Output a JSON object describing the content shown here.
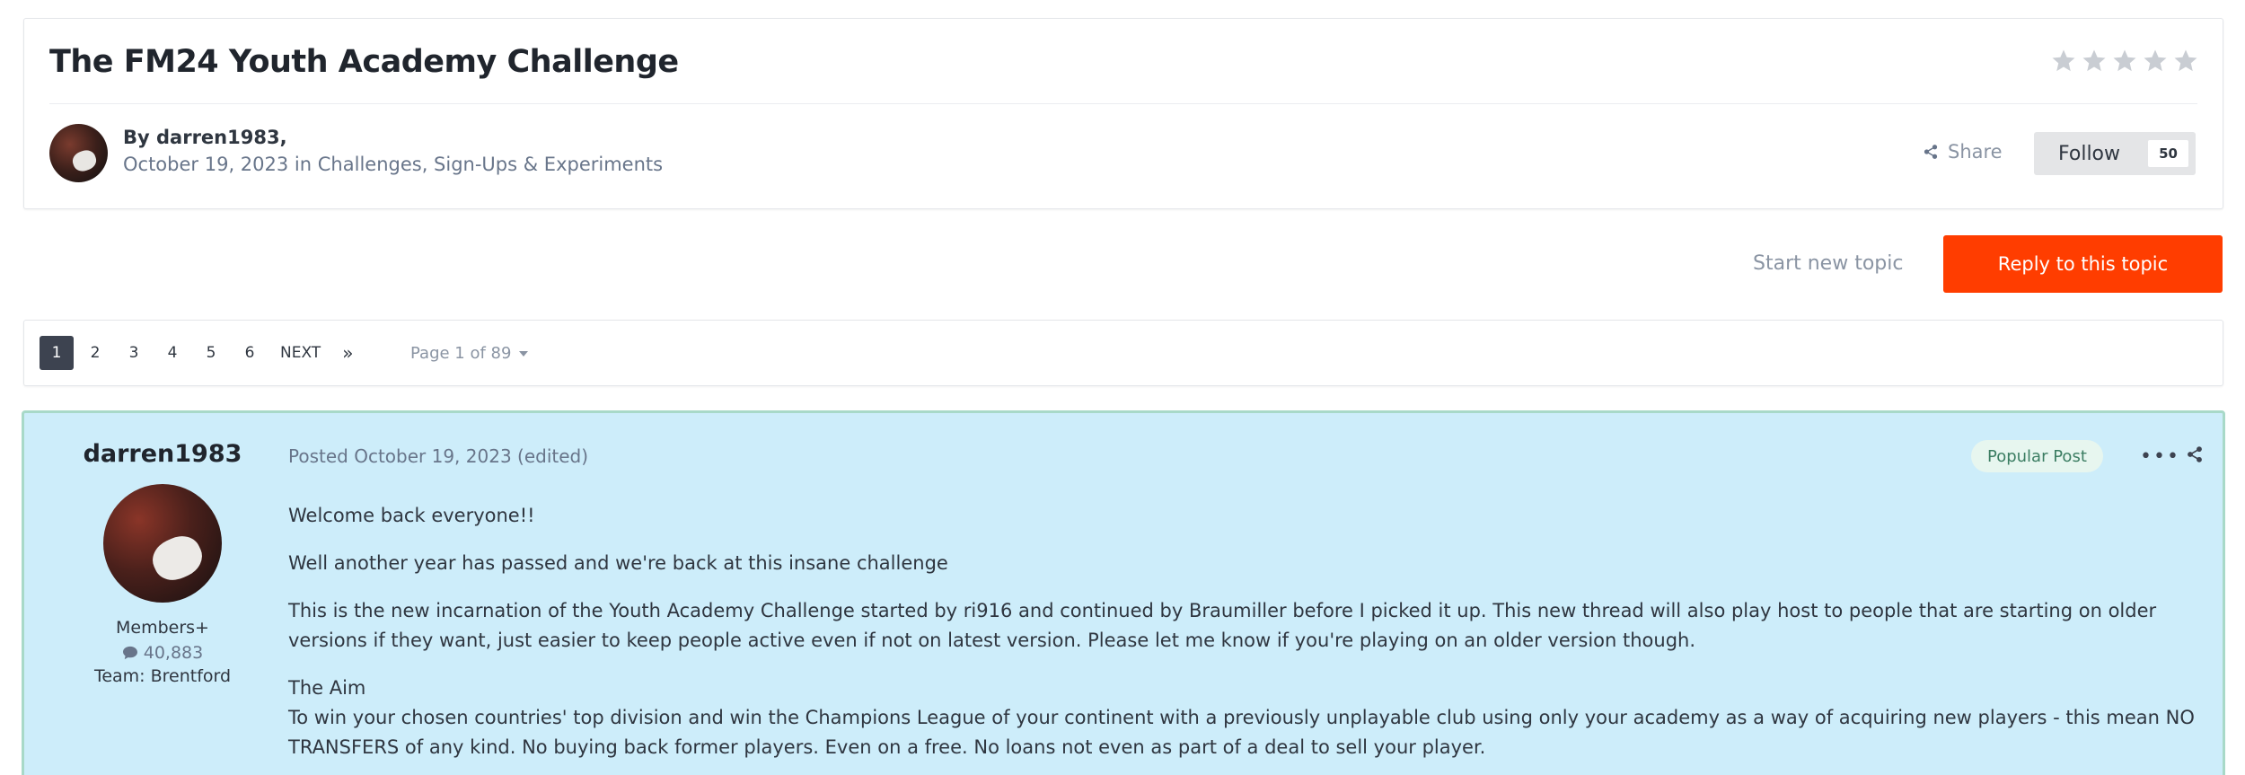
{
  "topic": {
    "title": "The FM24 Youth Academy Challenge",
    "rating_stars": 5,
    "author_prefix": "By darren1983,",
    "date": "October 19, 2023",
    "in_word": "in",
    "forum": "Challenges, Sign-Ups & Experiments",
    "share_label": "Share",
    "follow_label": "Follow",
    "follow_count": "50"
  },
  "actions": {
    "start_new_topic": "Start new topic",
    "reply_to_topic": "Reply to this topic"
  },
  "pagination": {
    "pages": [
      "1",
      "2",
      "3",
      "4",
      "5",
      "6"
    ],
    "active_page": "1",
    "next_label": "NEXT",
    "last_label": "»",
    "page_info": "Page 1 of 89"
  },
  "post": {
    "author": "darren1983",
    "group": "Members+",
    "post_count": "40,883",
    "team": "Team: Brentford",
    "posted": "Posted October 19, 2023 (edited)",
    "badge": "Popular Post",
    "menu_label": "•••",
    "paragraphs": [
      "Welcome back everyone!!",
      "Well another year has passed and we're back at this insane challenge",
      "This is the new incarnation of the Youth Academy Challenge started by ri916 and continued by Braumiller before I picked it up. This new thread will also play host to people that are starting on older versions if they want, just easier to keep people active even if not on latest version. Please let me know if you're playing on an older version though."
    ],
    "aim_heading": "The Aim",
    "aim_text": "To win your chosen countries' top division and win the Champions League of your continent with a previously unplayable club using only your academy as a way of acquiring new players - this mean NO TRANSFERS of any kind. No buying back former players. Even on a free. No loans not even as part of a deal to sell your player."
  },
  "colors": {
    "accent": "#ff3d00",
    "post_background": "#cdedfa",
    "post_border": "#a8d9c8",
    "active_page": "#3d4350"
  }
}
